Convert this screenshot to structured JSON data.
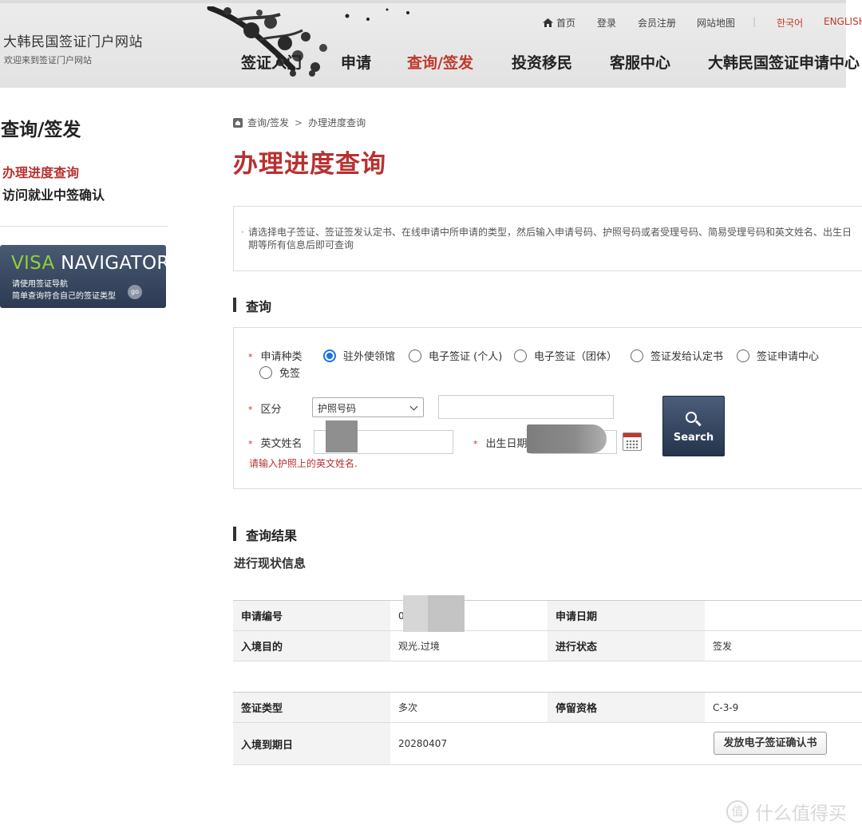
{
  "header": {
    "site_title": "大韩民国签证门户网站",
    "site_subtitle": "欢迎来到签证门户网站",
    "util": {
      "home": "首页",
      "login": "登录",
      "register": "会员注册",
      "sitemap": "网站地图",
      "korean": "한국어",
      "english": "ENGLISH"
    },
    "gnb": [
      "签证入门",
      "申请",
      "查询/签发",
      "投资移民",
      "客服中心",
      "大韩民国签证申请中心"
    ]
  },
  "sidebar": {
    "title": "查询/签发",
    "items": [
      "办理进度查询",
      "访问就业中签确认"
    ],
    "banner": {
      "title_a": "VISA",
      "title_b": "NAVIGATOR",
      "line1": "请使用签证导航",
      "line2": "简单查询符合自己的签证类型",
      "go": "go"
    }
  },
  "breadcrumb": {
    "parent": "查询/签发",
    "separator": ">",
    "current": "办理进度查询"
  },
  "page_title": "办理进度查询",
  "notice": "请选择电子签证、签证签发认定书、在线申请中所申请的类型，然后输入申请号码、护照号码或者受理号码、简易受理号码和英文姓名、出生日期等所有信息后即可查询",
  "query_section": {
    "heading": "查询",
    "req_mark": "*",
    "type_label": "申请种类",
    "type_options": [
      "驻外使领馆",
      "电子签证 (个人)",
      "电子签证（团体）",
      "签证发给认定书",
      "签证申请中心",
      "免签"
    ],
    "type_selected_index": 0,
    "division_label": "区分",
    "division_selected": "护照号码",
    "name_label": "英文姓名",
    "birth_label": "出生日期",
    "error": "请输入护照上的英文姓名.",
    "search_button": "Search"
  },
  "result_section": {
    "heading": "查询结果",
    "subheading": "进行现状信息",
    "table1": [
      {
        "k1": "申请编号",
        "v1": "00",
        "k2": "申请日期",
        "v2": ""
      },
      {
        "k1": "入境目的",
        "v1": "观光.过境",
        "k2": "进行状态",
        "v2": "签发"
      }
    ],
    "table2": [
      {
        "k1": "签证类型",
        "v1": "多次",
        "k2": "停留资格",
        "v2": "C-3-9"
      },
      {
        "k1": "入境到期日",
        "v1": "20280407",
        "k2": "",
        "v2": ""
      }
    ],
    "issue_button": "发放电子签证确认书"
  },
  "watermark": {
    "icon": "值",
    "text": "什么值得买"
  },
  "colors": {
    "accent_red": "#b83030",
    "nav_blue": "#2c3a52",
    "radio_blue": "#1a73e8"
  }
}
